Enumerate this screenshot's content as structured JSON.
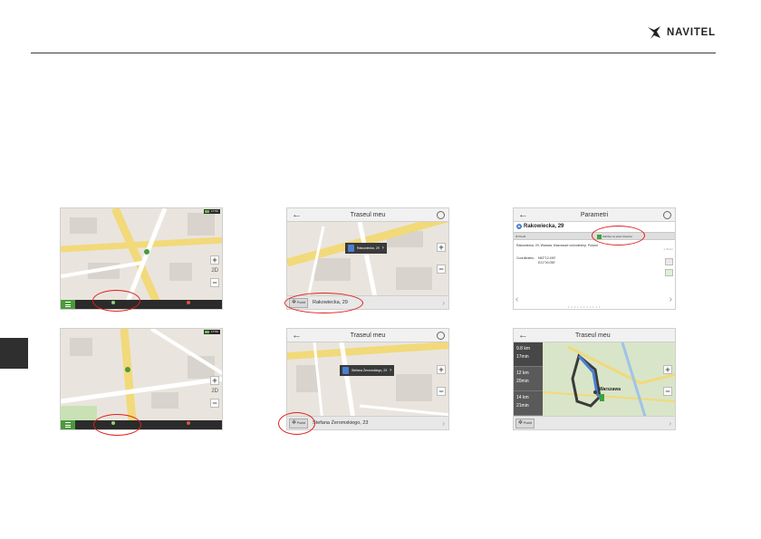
{
  "header": {
    "brand": "NAVITEL"
  },
  "colors": {
    "highlight": "#e0201c",
    "accent_green": "#4a9a3c",
    "route_blue": "#4a7fd0"
  },
  "shot1": {
    "menu_icon": "hamburger-icon",
    "battery_text": "17:59",
    "zoom_in": "+",
    "zoom_out": "−",
    "mode": "2D"
  },
  "shot2": {
    "title": "Traseul meu",
    "back": "←",
    "popup_address": "Rakowiecka, 29",
    "route_button": "Punkt",
    "address": "Rakowiecka, 29",
    "zoom_in": "+",
    "zoom_out": "−",
    "scale": "50 м"
  },
  "shot3": {
    "title": "Parametri",
    "back": "←",
    "place_name": "Rakowiecka, 29",
    "btn_route": "Punkt",
    "btn_start": "Začnite na pravi doverne",
    "full_address": "Rakowiecka, 29, Warsaw, Mazowsze voivodeship, Poland",
    "distance": "1.79 km",
    "coords_label": "Coordinates:",
    "lat": "N52°12.490'",
    "lon": "E21°00.050'",
    "prev": "‹",
    "next": "›"
  },
  "shot4": {
    "menu_icon": "hamburger-icon",
    "battery_text": "17:59",
    "zoom_in": "+",
    "zoom_out": "−",
    "mode": "2D"
  },
  "shot5": {
    "title": "Traseul meu",
    "back": "←",
    "popup_address": "Stefana Żeromskiego, 23",
    "route_button": "Punkt",
    "address": "Stefana Żeromskiego, 23",
    "zoom_in": "+",
    "zoom_out": "−",
    "street": "Stefana Zeromskiego"
  },
  "shot6": {
    "title": "Traseul meu",
    "back": "←",
    "routes": [
      {
        "dist": "9.8 km",
        "time": "17min"
      },
      {
        "dist": "12 km",
        "time": "20min"
      },
      {
        "dist": "14 km",
        "time": "21min"
      }
    ],
    "city": "Warszawa",
    "route_button": "Punkt",
    "zoom_in": "+",
    "zoom_out": "−"
  }
}
